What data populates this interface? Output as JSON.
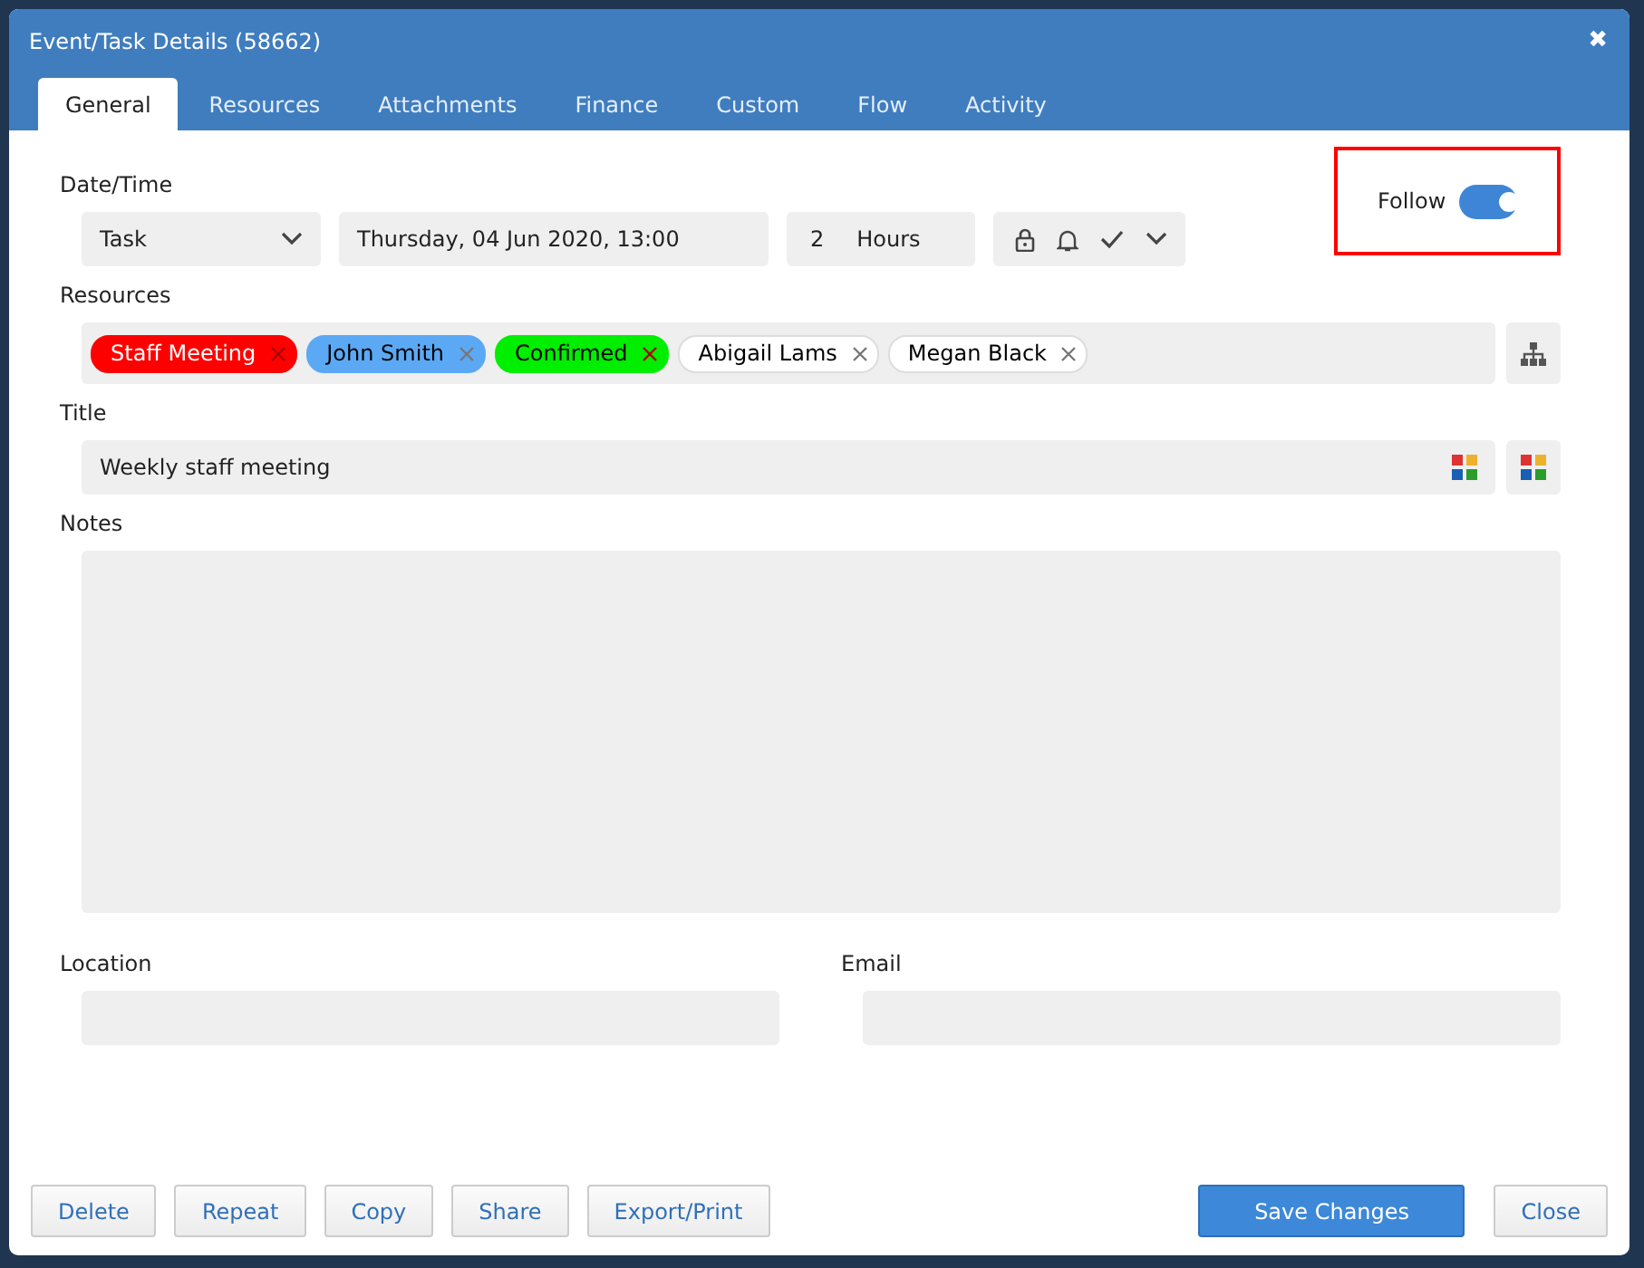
{
  "window": {
    "title": "Event/Task Details (58662)",
    "close": "✖"
  },
  "tabs": [
    {
      "label": "General",
      "selected": true
    },
    {
      "label": "Resources",
      "selected": false
    },
    {
      "label": "Attachments",
      "selected": false
    },
    {
      "label": "Finance",
      "selected": false
    },
    {
      "label": "Custom",
      "selected": false
    },
    {
      "label": "Flow",
      "selected": false
    },
    {
      "label": "Activity",
      "selected": false
    }
  ],
  "datetime": {
    "label": "Date/Time",
    "type": "Task",
    "date": "Thursday, 04 Jun 2020, 13:00",
    "duration": "2",
    "unit": "Hours"
  },
  "follow": {
    "label": "Follow",
    "on": true,
    "highlighted": true
  },
  "resources": {
    "label": "Resources",
    "tags": [
      {
        "label": "Staff Meeting",
        "color": "#ff0000"
      },
      {
        "label": "John Smith",
        "color": "#5ba9f4"
      },
      {
        "label": "Confirmed",
        "color": "#00ee00"
      },
      {
        "label": "Abigail Lams",
        "color": "#ffffff"
      },
      {
        "label": "Megan Black",
        "color": "#ffffff"
      }
    ]
  },
  "title": {
    "label": "Title",
    "value": "Weekly staff meeting"
  },
  "notes": {
    "label": "Notes"
  },
  "location": {
    "label": "Location"
  },
  "email": {
    "label": "Email"
  },
  "buttons_left": [
    "Delete",
    "Repeat",
    "Copy",
    "Share",
    "Export/Print"
  ],
  "buttons_right": [
    {
      "label": "Save Changes",
      "kind": "primary"
    },
    {
      "label": "Close",
      "kind": "default"
    }
  ]
}
